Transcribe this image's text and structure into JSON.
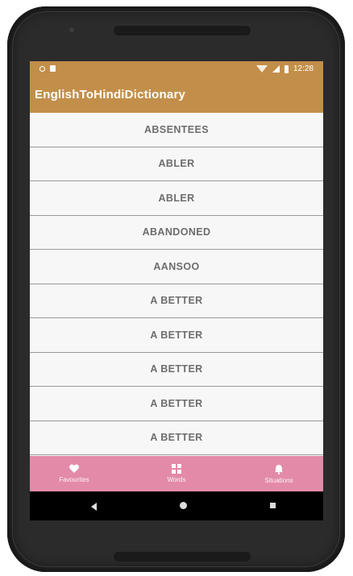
{
  "status_bar": {
    "time": "12:28"
  },
  "app_bar": {
    "title": "EnglishToHindiDictionary"
  },
  "words": [
    "ABSENTEES",
    "ABLER",
    "ABLER",
    "ABANDONED",
    "AANSOO",
    "A BETTER",
    "A BETTER",
    "A BETTER",
    "A BETTER",
    "A BETTER"
  ],
  "bottom_nav": {
    "items": [
      {
        "label": "Favourites",
        "icon": "heart-icon"
      },
      {
        "label": "Words",
        "icon": "grid-icon"
      },
      {
        "label": "Situations",
        "icon": "bell-icon"
      }
    ]
  },
  "colors": {
    "app_bar": "#c28f4a",
    "bottom_nav": "#e38aa8",
    "list_background": "#f7f7f7"
  }
}
